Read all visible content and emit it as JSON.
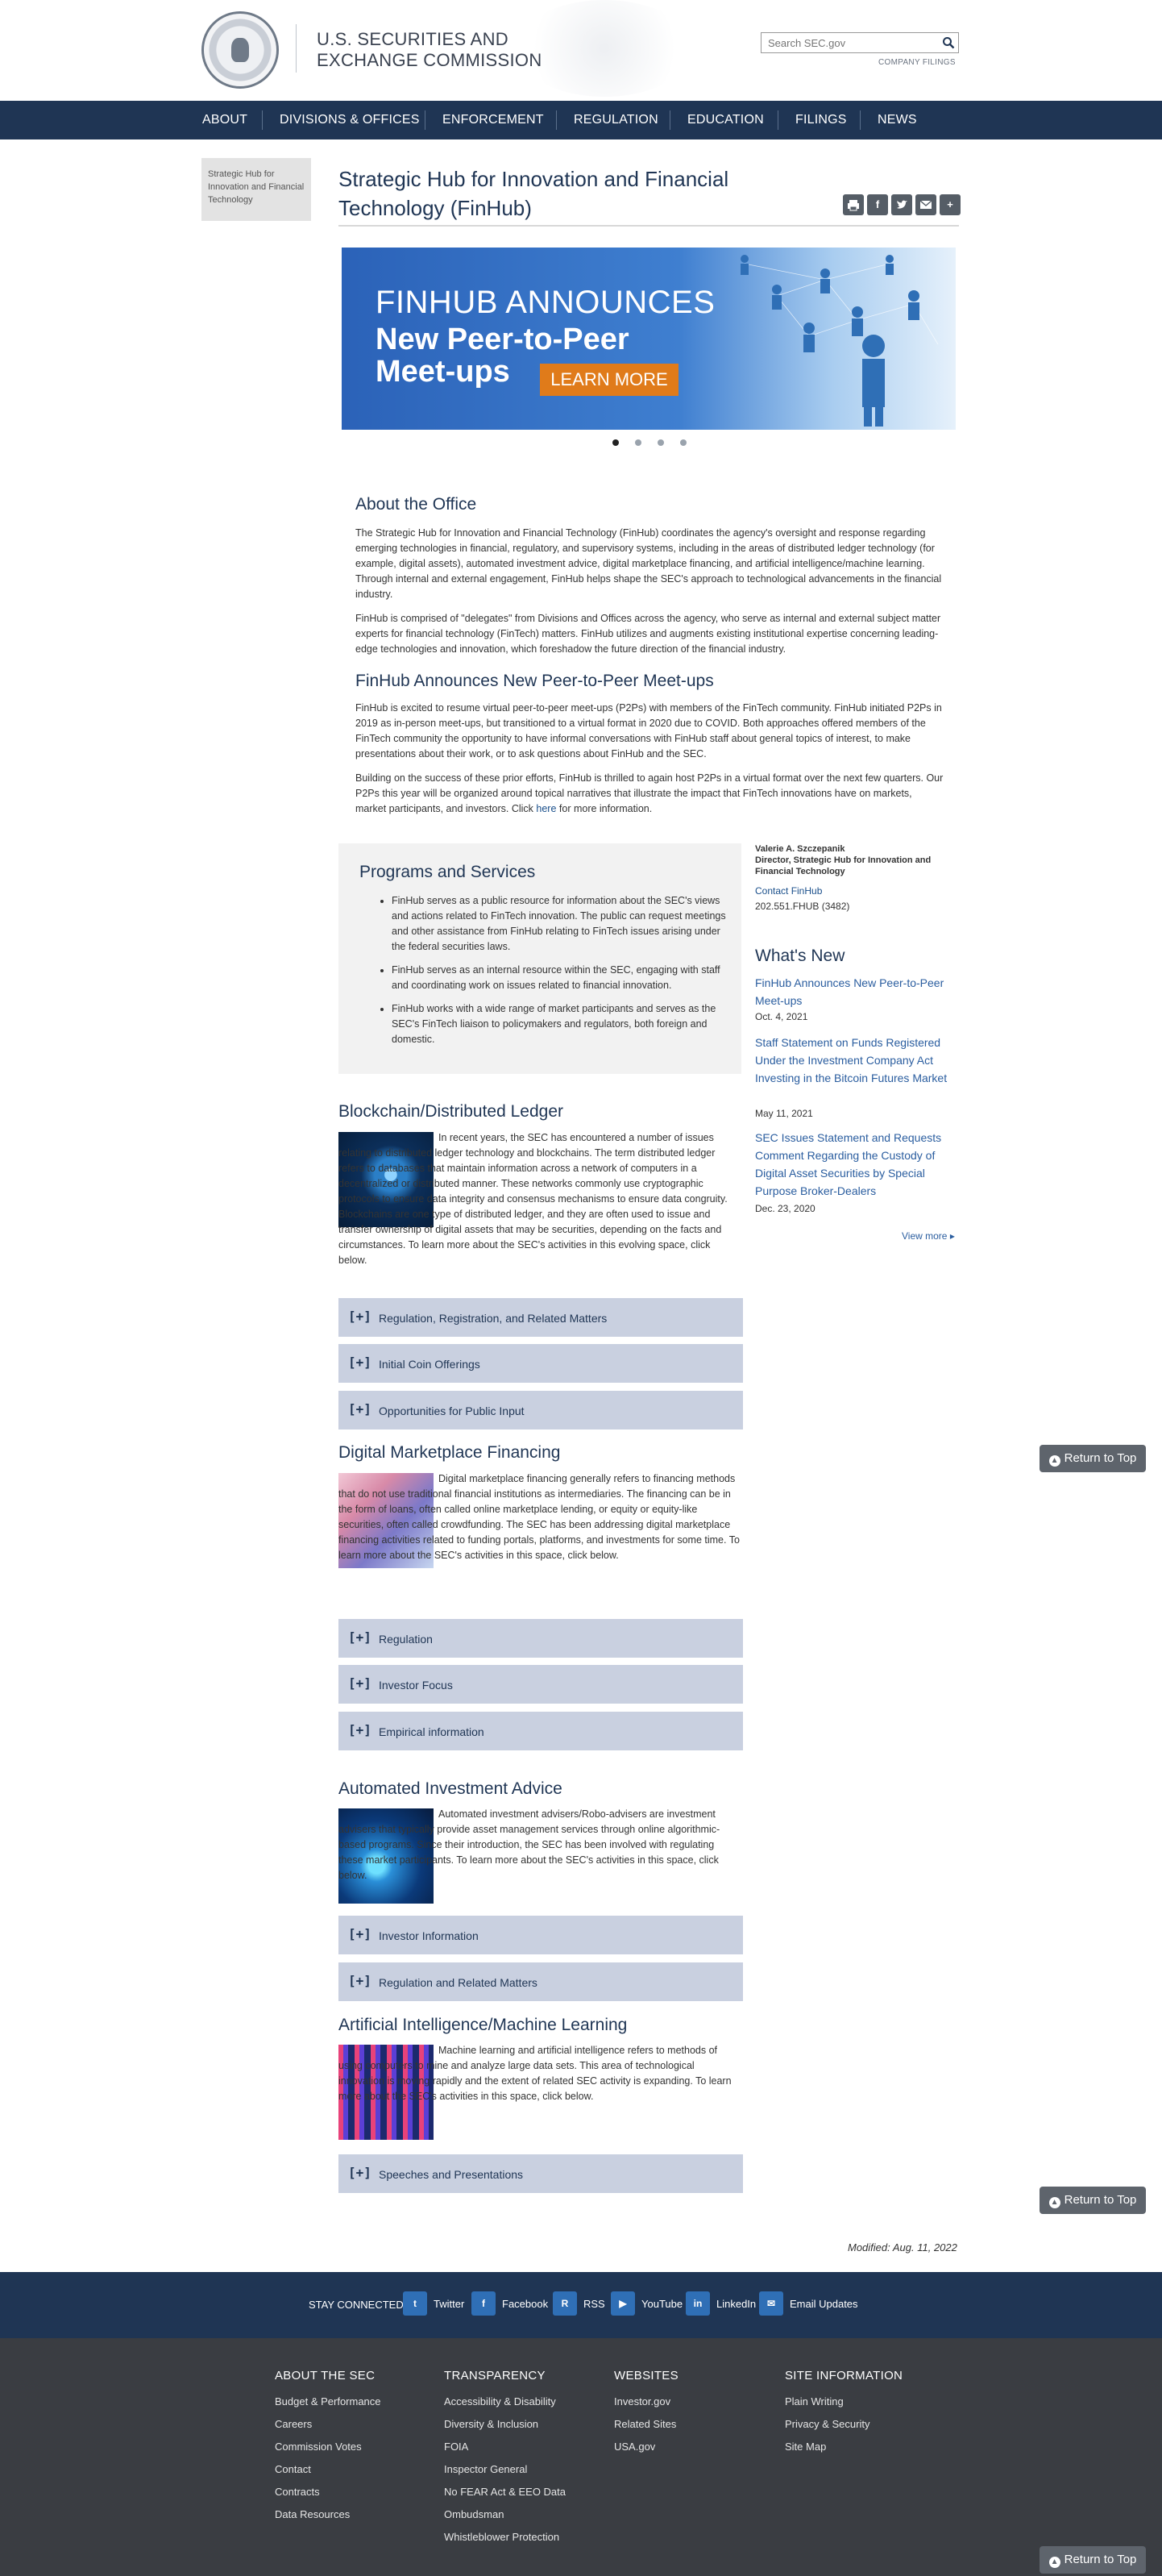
{
  "header": {
    "agency_line1": "U.S. SECURITIES AND",
    "agency_line2": "EXCHANGE COMMISSION",
    "search_placeholder": "Search SEC.gov",
    "company_filings": "COMPANY FILINGS"
  },
  "nav": [
    "ABOUT",
    "DIVISIONS & OFFICES",
    "ENFORCEMENT",
    "REGULATION",
    "EDUCATION",
    "FILINGS",
    "NEWS"
  ],
  "sidebar": {
    "label": "Strategic Hub for Innovation and Financial Technology"
  },
  "page": {
    "title_line1": "Strategic Hub for Innovation and Financial",
    "title_line2": "Technology (FinHub)"
  },
  "share_icons": [
    "print-icon",
    "facebook-icon",
    "twitter-icon",
    "email-icon",
    "plus-icon"
  ],
  "banner": {
    "top": "FINHUB ANNOUNCES",
    "main_line1": "New Peer-to-Peer",
    "main_line2": "Meet-ups",
    "cta": "LEARN MORE"
  },
  "about": {
    "heading": "About the Office",
    "p1": "The Strategic Hub for Innovation and Financial Technology (FinHub) coordinates the agency's oversight and response regarding emerging technologies in financial, regulatory, and supervisory systems, including in the areas of distributed ledger technology (for example, digital assets), automated investment advice, digital marketplace financing, and artificial intelligence/machine learning. Through internal and external engagement, FinHub helps shape the SEC's approach to technological advancements in the financial industry.",
    "p2": "FinHub is comprised of \"delegates\" from Divisions and Offices across the agency, who serve as internal and external subject matter experts for financial technology (FinTech) matters. FinHub utilizes and augments existing institutional expertise concerning leading-edge technologies and innovation, which foreshadow the future direction of the financial industry."
  },
  "meetups": {
    "heading": "FinHub Announces New Peer-to-Peer Meet-ups",
    "p1": "FinHub is excited to resume virtual peer-to-peer meet-ups (P2Ps) with members of the FinTech community. FinHub initiated P2Ps in 2019 as in-person meet-ups, but transitioned to a virtual format in 2020 due to COVID. Both approaches offered members of the FinTech community the opportunity to have informal conversations with FinHub staff about general topics of interest, to make presentations about their work, or to ask questions about FinHub and the SEC.",
    "p2_before": "Building on the success of these prior efforts, FinHub is thrilled to again host P2Ps in a virtual format over the next few quarters. Our P2Ps this year will be organized around topical narratives that illustrate the impact that FinTech innovations have on markets, market participants, and investors. Click ",
    "p2_link": "here",
    "p2_after": " for more information."
  },
  "programs": {
    "heading": "Programs and Services",
    "items": [
      "FinHub serves as a public resource for information about the SEC's views and actions related to FinTech innovation. The public can request meetings and other assistance from FinHub relating to FinTech issues arising under the federal securities laws.",
      "FinHub serves as an internal resource within the SEC, engaging with staff and coordinating work on issues related to financial innovation.",
      "FinHub works with a wide range of market participants and serves as the SEC's FinTech liaison to policymakers and regulators, both foreign and domestic."
    ]
  },
  "contact": {
    "name": "Valerie A. Szczepanik",
    "role": "Director, Strategic Hub for Innovation and Financial Technology",
    "link": "Contact FinHub",
    "phone": "202.551.FHUB (3482)"
  },
  "whats_new": {
    "heading": "What's New",
    "items": [
      {
        "title": "FinHub Announces New Peer-to-Peer Meet-ups",
        "date": "Oct. 4, 2021"
      },
      {
        "title": "Staff Statement on Funds Registered Under the Investment Company Act Investing in the Bitcoin Futures Market",
        "date": "May 11, 2021"
      },
      {
        "title": "SEC Issues Statement and Requests Comment Regarding the Custody of Digital Asset Securities by Special Purpose Broker-Dealers",
        "date": "Dec. 23, 2020"
      }
    ],
    "view_more": "View more"
  },
  "blockchain": {
    "heading": "Blockchain/Distributed Ledger",
    "text": "In recent years, the SEC has encountered a number of issues relating to distributed ledger technology and blockchains. The term distributed ledger refers to databases that maintain information across a network of computers in a decentralized or distributed manner. These networks commonly use cryptographic protocols to ensure data integrity and consensus mechanisms to ensure data congruity. Blockchains are one type of distributed ledger, and they are often used to issue and transfer ownership of digital assets that may be securities, depending on the facts and circumstances. To learn more about the SEC's activities in this evolving space, click below.",
    "accordions": [
      "Regulation, Registration, and Related Matters",
      "Initial Coin Offerings",
      "Opportunities for Public Input"
    ]
  },
  "dmf": {
    "heading": "Digital Marketplace Financing",
    "text": "Digital marketplace financing generally refers to financing methods that do not use traditional financial institutions as intermediaries. The financing can be in the form of loans, often called online marketplace lending, or equity or equity-like securities, often called crowdfunding. The SEC has been addressing digital marketplace financing activities related to funding portals, platforms, and investments for some time. To learn more about the SEC's activities in this space, click below.",
    "accordions": [
      "Regulation",
      "Investor Focus",
      "Empirical information"
    ]
  },
  "aia": {
    "heading": "Automated Investment Advice",
    "text": "Automated investment advisers/Robo-advisers are investment advisers that typically provide asset management services through online algorithmic-based programs. Since their introduction, the SEC has been involved with regulating these market participants. To learn more about the SEC's activities in this space, click below.",
    "accordions": [
      "Investor Information",
      "Regulation and Related Matters"
    ]
  },
  "ai": {
    "heading": "Artificial Intelligence/Machine Learning",
    "text": "Machine learning and artificial intelligence refers to methods of using computers to mine and analyze large data sets. This area of technological innovation is moving rapidly and the extent of related SEC activity is expanding. To learn more about the SEC's activities in this space, click below.",
    "accordions": [
      "Speeches and Presentations"
    ]
  },
  "accordion_marker": "[+]",
  "return_top": "Return to Top",
  "modified": "Modified: Aug. 11, 2022",
  "footer": {
    "stay_connected": "STAY CONNECTED",
    "social": [
      {
        "icon": "twitter-icon",
        "glyph": "t",
        "label": "Twitter"
      },
      {
        "icon": "facebook-icon",
        "glyph": "f",
        "label": "Facebook"
      },
      {
        "icon": "rss-icon",
        "glyph": "R",
        "label": "RSS"
      },
      {
        "icon": "youtube-icon",
        "glyph": "▶",
        "label": "YouTube"
      },
      {
        "icon": "linkedin-icon",
        "glyph": "in",
        "label": "LinkedIn"
      },
      {
        "icon": "email-icon",
        "glyph": "✉",
        "label": "Email Updates"
      }
    ],
    "columns": [
      {
        "heading": "ABOUT THE SEC",
        "links": [
          "Budget & Performance",
          "Careers",
          "Commission Votes",
          "Contact",
          "Contracts",
          "Data Resources"
        ]
      },
      {
        "heading": "TRANSPARENCY",
        "links": [
          "Accessibility & Disability",
          "Diversity & Inclusion",
          "FOIA",
          "Inspector General",
          "No FEAR Act & EEO Data",
          "Ombudsman",
          "Whistleblower Protection"
        ]
      },
      {
        "heading": "WEBSITES",
        "links": [
          "Investor.gov",
          "Related Sites",
          "USA.gov"
        ]
      },
      {
        "heading": "SITE INFORMATION",
        "links": [
          "Plain Writing",
          "Privacy & Security",
          "Site Map"
        ]
      }
    ]
  },
  "colors": {
    "navy": "#1f3554",
    "accordion": "#c9d0e0",
    "link": "#2a5d9f",
    "banner_cta": "#e07b1a",
    "footer": "#3a3d42"
  }
}
